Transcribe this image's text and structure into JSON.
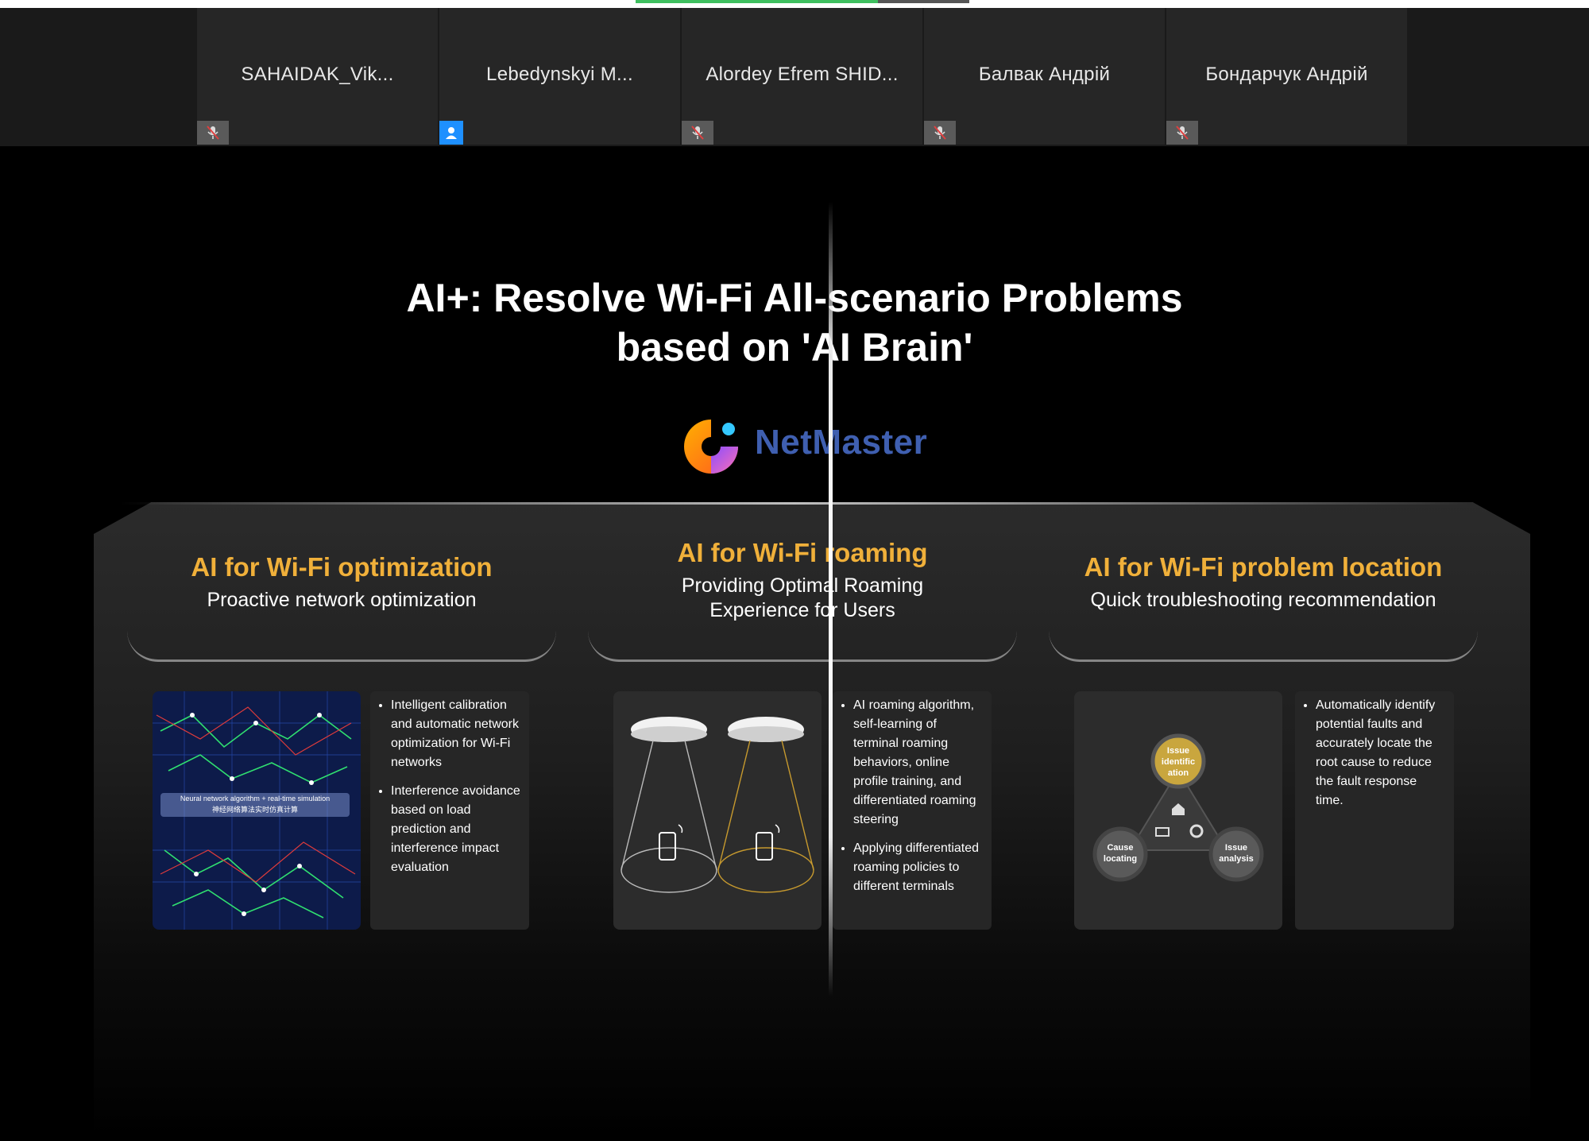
{
  "participants": [
    {
      "name": "SAHAIDAK_Vik...",
      "badge": "mic-off"
    },
    {
      "name": "Lebedynskyi M...",
      "badge": "user"
    },
    {
      "name": "Alordey Efrem SHID...",
      "badge": "mic-off"
    },
    {
      "name": "Балвак Андрій",
      "badge": "mic-off"
    },
    {
      "name": "Бондарчук Андрій",
      "badge": "mic-off"
    }
  ],
  "slide": {
    "title_line1": "AI+: Resolve Wi-Fi All-scenario Problems",
    "title_line2": "based on 'AI Brain'",
    "logo_text": "NetMaster",
    "columns": [
      {
        "heading": "AI for Wi-Fi optimization",
        "subtitle": "Proactive network optimization",
        "image_caption_en": "Neural network algorithm + real-time simulation",
        "image_caption_cn": "神经网络算法实时仿真计算",
        "bullets": [
          "Intelligent calibration and automatic network optimization for Wi-Fi networks",
          "Interference avoidance based on load prediction and interference impact evaluation"
        ]
      },
      {
        "heading": "AI for Wi-Fi roaming",
        "subtitle_line1": "Providing Optimal Roaming",
        "subtitle_line2": "Experience for Users",
        "bullets": [
          "AI roaming algorithm, self-learning of terminal roaming behaviors, online profile training, and differentiated roaming steering",
          "Applying differentiated roaming policies to different terminals"
        ]
      },
      {
        "heading": "AI for Wi-Fi problem location",
        "subtitle": "Quick troubleshooting recommendation",
        "cycle_labels": {
          "top": "Issue identific ation",
          "left": "Cause locating",
          "right": "Issue analysis"
        },
        "bullets": [
          "Automatically identify potential faults and accurately locate the root cause to reduce the fault response time."
        ]
      }
    ]
  },
  "colors": {
    "accent_heading": "#f0b03a",
    "logo_blue": "#3f5fb0",
    "share_green": "#3fbf5f",
    "user_badge": "#1e90ff"
  }
}
